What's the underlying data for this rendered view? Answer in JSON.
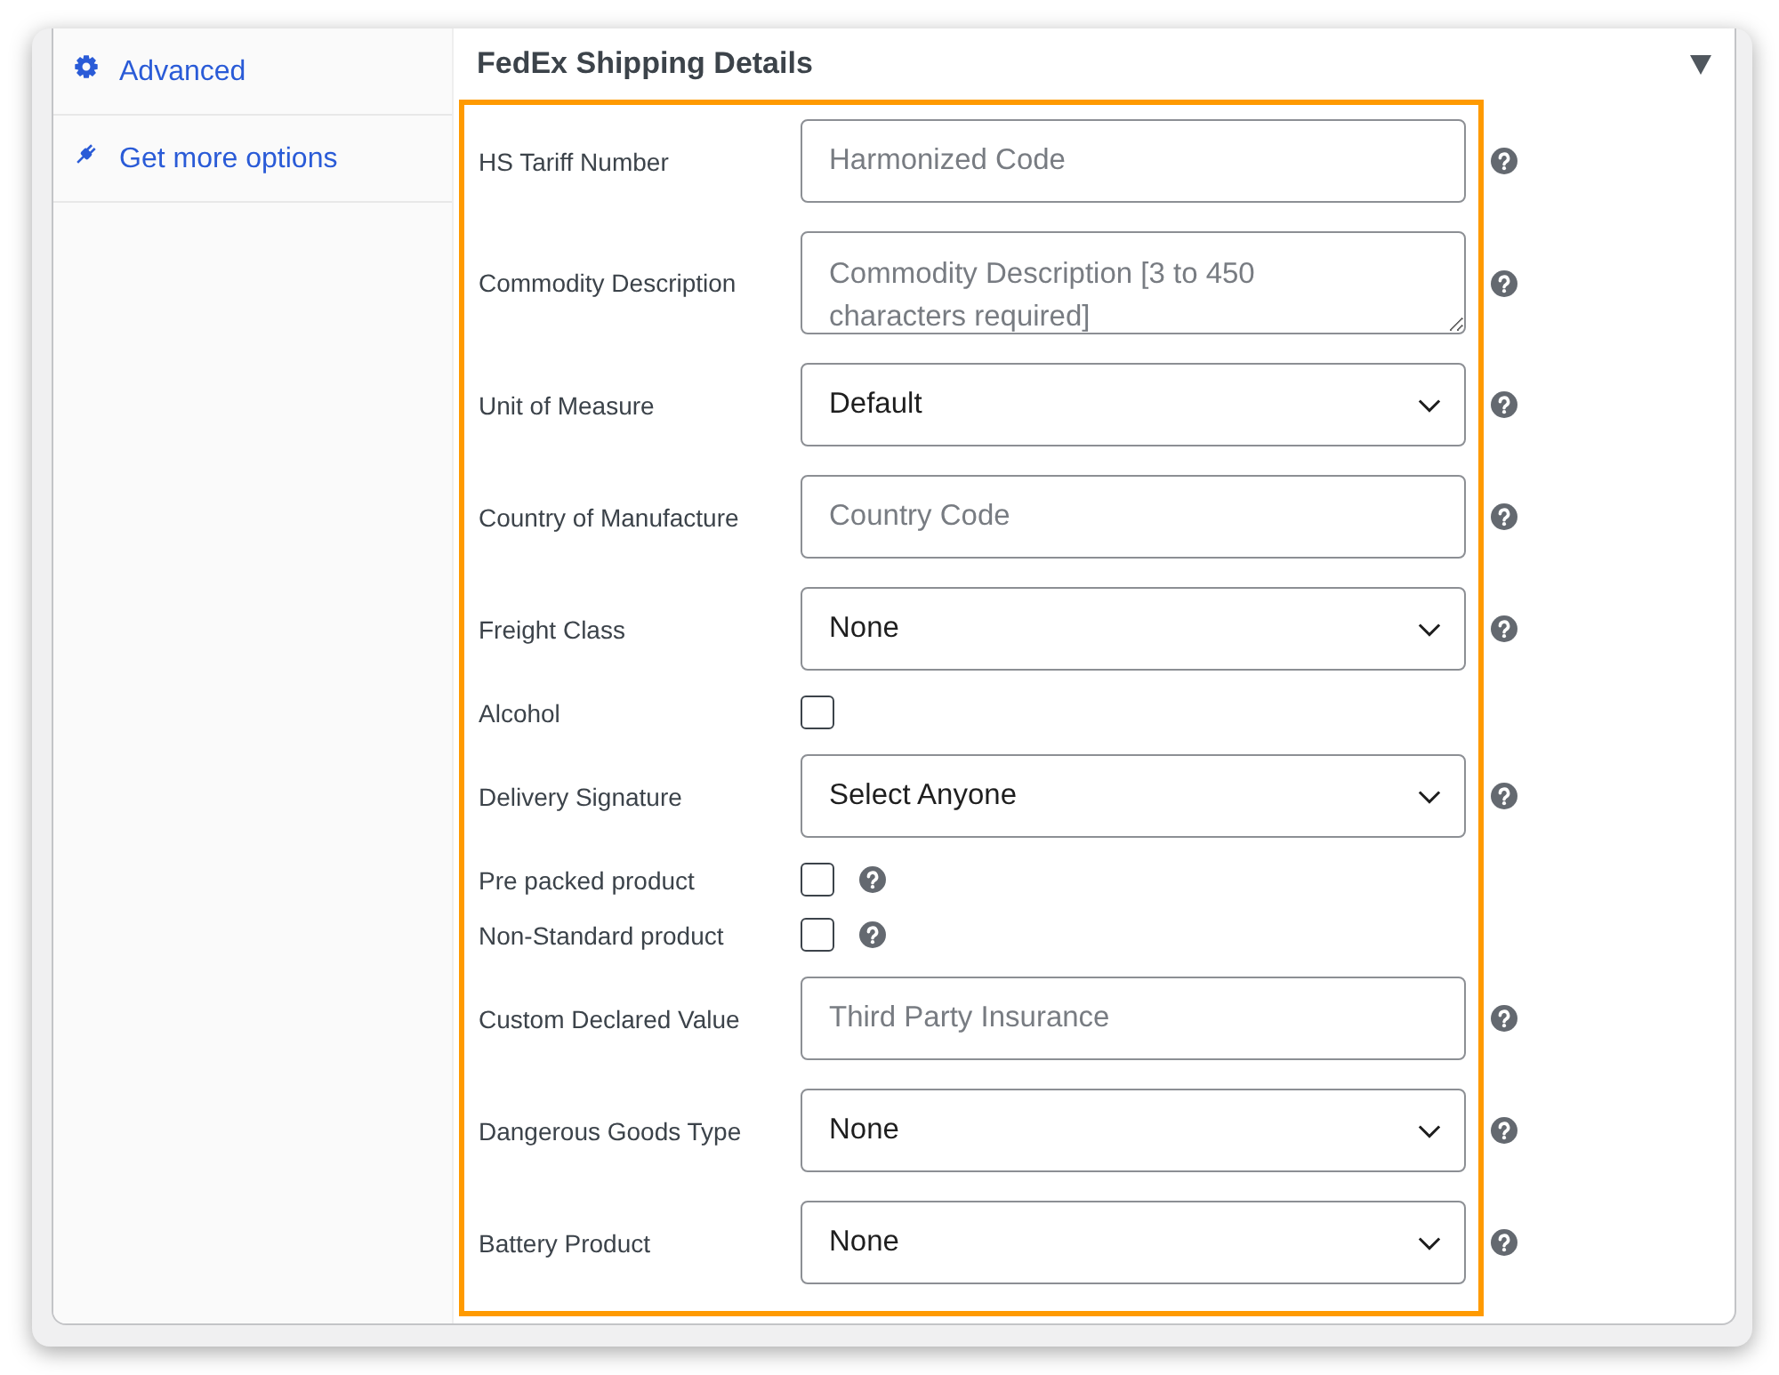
{
  "sidebar": {
    "items": [
      {
        "label": "Advanced",
        "selected": false
      },
      {
        "label": "Get more options",
        "selected": false
      }
    ]
  },
  "panel": {
    "title": "FedEx Shipping Details",
    "expanded": true,
    "highlighted": true
  },
  "fields": [
    {
      "kind": "text",
      "label": "HS Tariff Number",
      "placeholder": "Harmonized Code",
      "help": true
    },
    {
      "kind": "textarea",
      "label": "Commodity Description",
      "placeholder": "Commodity Description [3 to 450 characters required]",
      "help": true
    },
    {
      "kind": "select",
      "label": "Unit of Measure",
      "value": "Default",
      "help": true
    },
    {
      "kind": "text",
      "label": "Country of Manufacture",
      "placeholder": "Country Code",
      "help": true
    },
    {
      "kind": "select",
      "label": "Freight Class",
      "value": "None",
      "help": true
    },
    {
      "kind": "checkbox",
      "label": "Alcohol",
      "checked": false,
      "help": false
    },
    {
      "kind": "select",
      "label": "Delivery Signature",
      "value": "Select Anyone",
      "help": true
    },
    {
      "kind": "checkbox",
      "label": "Pre packed product",
      "checked": false,
      "help": true
    },
    {
      "kind": "checkbox",
      "label": "Non-Standard product",
      "checked": false,
      "help": true
    },
    {
      "kind": "text",
      "label": "Custom Declared Value",
      "placeholder": "Third Party Insurance",
      "help": true
    },
    {
      "kind": "select",
      "label": "Dangerous Goods Type",
      "value": "None",
      "help": true
    },
    {
      "kind": "select",
      "label": "Battery Product",
      "value": "None",
      "help": true
    }
  ]
}
